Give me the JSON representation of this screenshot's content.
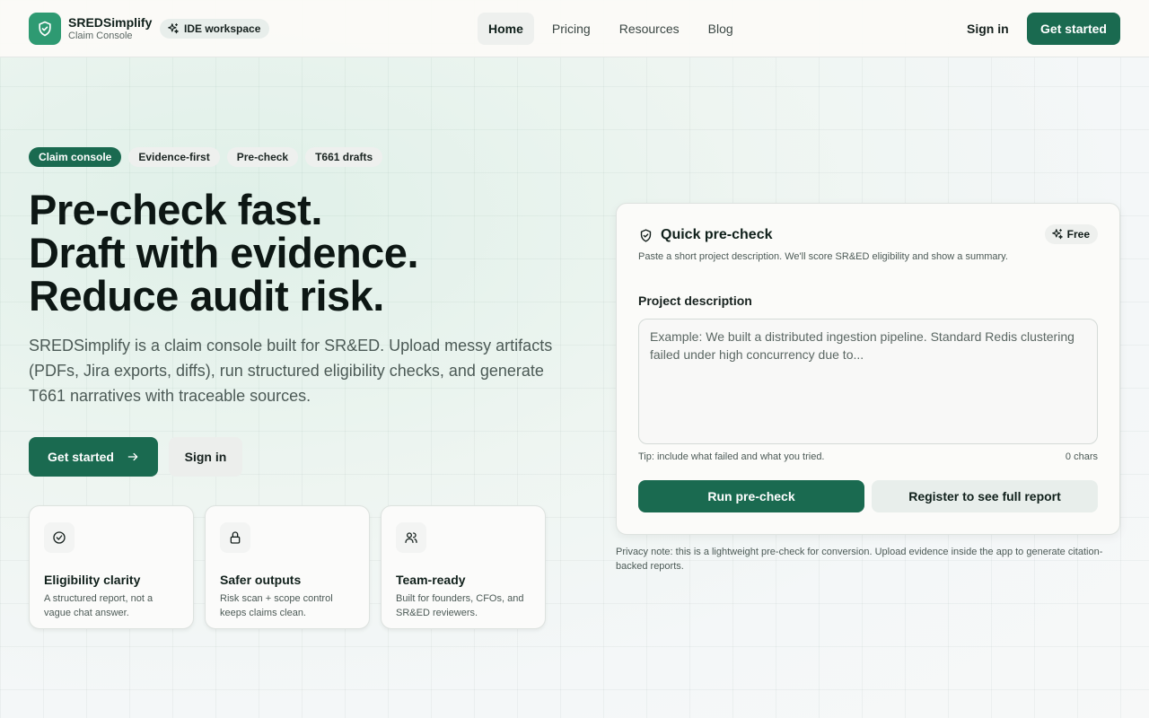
{
  "header": {
    "brand_name": "SREDSimplify",
    "brand_sub": "Claim Console",
    "workspace_pill": "IDE workspace",
    "nav": [
      {
        "label": "Home",
        "active": true
      },
      {
        "label": "Pricing"
      },
      {
        "label": "Resources"
      },
      {
        "label": "Blog"
      }
    ],
    "sign_in": "Sign in",
    "get_started": "Get started"
  },
  "hero": {
    "tags": [
      "Claim console",
      "Evidence-first",
      "Pre-check",
      "T661 drafts"
    ],
    "headline": [
      "Pre-check fast.",
      "Draft with evidence.",
      "Reduce audit risk."
    ],
    "lede": "SREDSimplify is a claim console built for SR&ED. Upload messy artifacts (PDFs, Jira exports, diffs), run structured eligibility checks, and generate T661 narratives with traceable sources.",
    "cta_primary": "Get started",
    "cta_secondary": "Sign in",
    "features": [
      {
        "icon": "check-circle-icon",
        "title": "Eligibility clarity",
        "desc": "A structured report, not a vague chat answer."
      },
      {
        "icon": "lock-icon",
        "title": "Safer outputs",
        "desc": "Risk scan + scope control keeps claims clean."
      },
      {
        "icon": "users-icon",
        "title": "Team-ready",
        "desc": "Built for founders, CFOs, and SR&ED reviewers."
      }
    ]
  },
  "precheck": {
    "title": "Quick pre-check",
    "badge": "Free",
    "subtitle": "Paste a short project description. We'll score SR&ED eligibility and show a summary.",
    "field_label": "Project description",
    "placeholder": "Example: We built a distributed ingestion pipeline. Standard Redis clustering failed under high concurrency due to...",
    "value": "",
    "tip": "Tip: include what failed and what you tried.",
    "char_count": "0 chars",
    "run_button": "Run pre-check",
    "register_button": "Register to see full report",
    "privacy_note": "Privacy note: this is a lightweight pre-check for conversion. Upload evidence inside the app to generate citation-backed reports."
  },
  "colors": {
    "brand": "#1a6a50",
    "logo": "#2e9a72",
    "text": "#0f1a17"
  }
}
